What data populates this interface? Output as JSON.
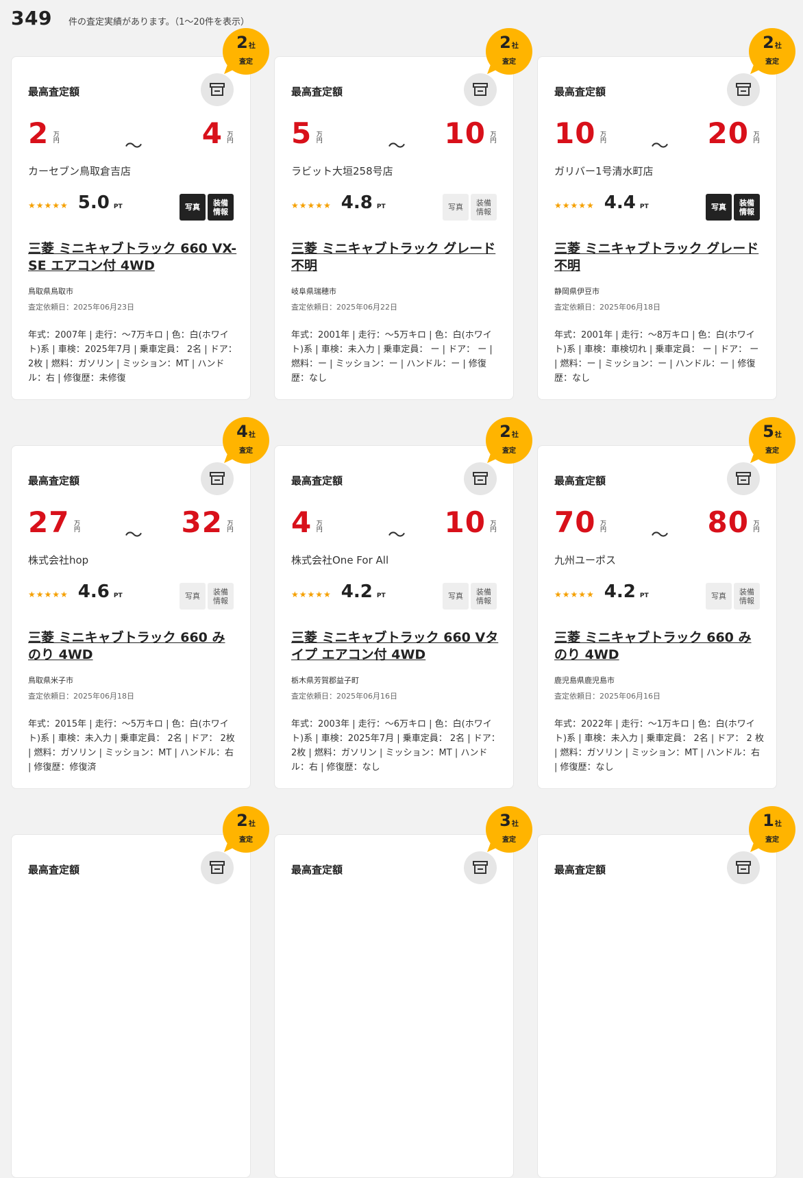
{
  "header": {
    "count": "349",
    "summary": "件の査定実績があります。（1〜20件を表示）"
  },
  "common": {
    "max_label": "最高査定額",
    "unit_man": "万",
    "unit_en": "円",
    "tilde": "〜",
    "badge_unit": "社",
    "badge_sub": "査定",
    "pt": "PT",
    "tag_photo": "写真",
    "tag_equip": "装備情報",
    "date_prefix": "査定依頼日："
  },
  "colors": {
    "accent_red": "#d8101a",
    "badge_yellow": "#ffb400",
    "star": "#f5a000"
  },
  "cards": [
    {
      "companies": "2",
      "low": "2",
      "high": "4",
      "shop": "カーセブン鳥取倉吉店",
      "stars": "★★★★★",
      "score": "5.0",
      "photo_active": true,
      "equip_active": true,
      "title": "三菱 ミニキャブトラック 660 VX-SE エアコン付 4WD",
      "location": "鳥取県鳥取市",
      "date": "査定依頼日：2025年06月23日",
      "specs": "年式：2007年 | 走行：〜7万キロ | 色：白(ホワイト)系 | 車検：2025年7月 | 乗車定員： 2名 | ドア： 2枚 | 燃料：ガソリン | ミッション：MT | ハンドル：右 | 修復歴：未修復"
    },
    {
      "companies": "2",
      "low": "5",
      "high": "10",
      "shop": "ラビット大垣258号店",
      "stars": "★★★★★",
      "score": "4.8",
      "photo_active": false,
      "equip_active": false,
      "title": "三菱 ミニキャブトラック グレード不明",
      "location": "岐阜県瑞穂市",
      "date": "査定依頼日：2025年06月22日",
      "specs": "年式：2001年 | 走行：〜5万キロ | 色：白(ホワイト)系 | 車検：未入力 | 乗車定員： ー | ドア： ー | 燃料：ー | ミッション：ー | ハンドル：ー | 修復歴：なし"
    },
    {
      "companies": "2",
      "low": "10",
      "high": "20",
      "shop": "ガリバー1号清水町店",
      "stars": "★★★★★",
      "score": "4.4",
      "photo_active": true,
      "equip_active": true,
      "title": "三菱 ミニキャブトラック グレード不明",
      "location": "静岡県伊豆市",
      "date": "査定依頼日：2025年06月18日",
      "specs": "年式：2001年 | 走行：〜8万キロ | 色：白(ホワイト)系 | 車検：車検切れ | 乗車定員： ー | ドア： ー | 燃料：ー | ミッション：ー | ハンドル：ー | 修復歴：なし"
    },
    {
      "companies": "4",
      "low": "27",
      "high": "32",
      "shop": "株式会社hop",
      "stars": "★★★★★",
      "score": "4.6",
      "photo_active": false,
      "equip_active": false,
      "title": "三菱 ミニキャブトラック 660 みのり 4WD",
      "location": "鳥取県米子市",
      "date": "査定依頼日：2025年06月18日",
      "specs": "年式：2015年 | 走行：〜5万キロ | 色：白(ホワイト)系 | 車検：未入力 | 乗車定員： 2名 | ドア： 2枚 | 燃料：ガソリン | ミッション：MT | ハンドル：右 | 修復歴：修復済"
    },
    {
      "companies": "2",
      "low": "4",
      "high": "10",
      "shop": "株式会社One For All",
      "stars": "★★★★★",
      "score": "4.2",
      "photo_active": false,
      "equip_active": false,
      "title": "三菱 ミニキャブトラック 660 Vタイプ エアコン付 4WD",
      "location": "栃木県芳賀郡益子町",
      "date": "査定依頼日：2025年06月16日",
      "specs": "年式：2003年 | 走行：〜6万キロ | 色：白(ホワイト)系 | 車検：2025年7月 | 乗車定員： 2名 | ドア： 2枚 | 燃料：ガソリン | ミッション：MT | ハンドル：右 | 修復歴：なし"
    },
    {
      "companies": "5",
      "low": "70",
      "high": "80",
      "shop": "九州ユーポス",
      "stars": "★★★★★",
      "score": "4.2",
      "photo_active": false,
      "equip_active": false,
      "title": "三菱 ミニキャブトラック 660 みのり 4WD",
      "location": "鹿児島県鹿児島市",
      "date": "査定依頼日：2025年06月16日",
      "specs": "年式：2022年 | 走行：〜1万キロ | 色：白(ホワイト)系 | 車検：未入力 | 乗車定員： 2名 | ドア： 2 枚 | 燃料：ガソリン | ミッション：MT | ハンドル：右 | 修復歴：なし"
    },
    {
      "companies": "2"
    },
    {
      "companies": "3"
    },
    {
      "companies": "1"
    }
  ]
}
